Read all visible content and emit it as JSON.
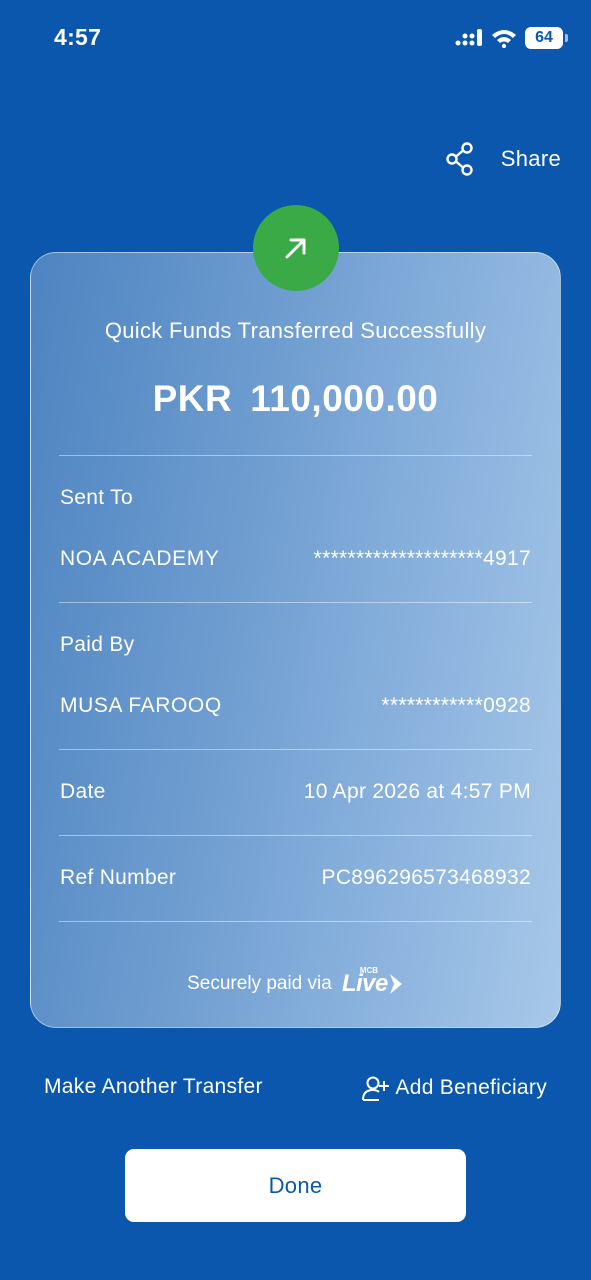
{
  "status_bar": {
    "time": "4:57",
    "battery": "64"
  },
  "header": {
    "share_label": "Share"
  },
  "receipt": {
    "title": "Quick Funds Transferred Successfully",
    "currency": "PKR",
    "amount": "110,000.00",
    "sent_to": {
      "label": "Sent To",
      "name": "NOA ACADEMY",
      "account": "********************4917"
    },
    "paid_by": {
      "label": "Paid By",
      "name": "MUSA FAROOQ",
      "account": "************0928"
    },
    "date": {
      "label": "Date",
      "value": "10 Apr 2026 at 4:57 PM"
    },
    "ref": {
      "label": "Ref Number",
      "value": "PC896296573468932"
    },
    "footer": {
      "text": "Securely paid via",
      "logo_text": "Live",
      "logo_small": "MCB"
    }
  },
  "actions": {
    "make_another": "Make Another Transfer",
    "add_beneficiary": "Add Beneficiary",
    "done": "Done"
  },
  "colors": {
    "background": "#0a57ad",
    "success": "#3aaa47",
    "button_bg": "#ffffff",
    "button_text": "#0a57ad"
  }
}
